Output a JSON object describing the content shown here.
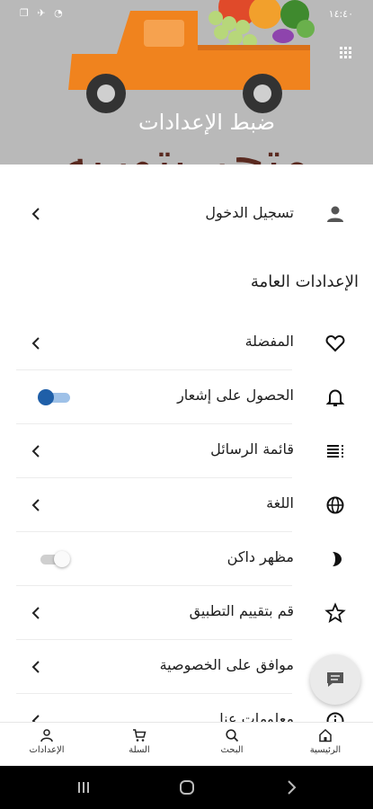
{
  "status_bar": {
    "time": "١٤:٤٠",
    "icons": "❐ ✈ ◔"
  },
  "header": {
    "title": "ضبط الإعدادات",
    "brand": "متجر بتوريه"
  },
  "login": {
    "label": "تسجيل الدخول",
    "icon": "person-icon"
  },
  "general_settings": {
    "title": "الإعدادات العامة",
    "items": [
      {
        "label": "المفضلة",
        "icon": "heart-icon",
        "control": "chevron"
      },
      {
        "label": "الحصول على إشعار",
        "icon": "bell-icon",
        "control": "toggle",
        "on": true
      },
      {
        "label": "قائمة الرسائل",
        "icon": "list-icon",
        "control": "chevron"
      },
      {
        "label": "اللغة",
        "icon": "globe-icon",
        "control": "chevron"
      },
      {
        "label": "مظهر داكن",
        "icon": "moon-icon",
        "control": "toggle",
        "on": false
      },
      {
        "label": "قم بتقييم التطبيق",
        "icon": "star-icon",
        "control": "chevron"
      },
      {
        "label": "موافق على الخصوصية",
        "icon": "shield-icon",
        "control": "chevron"
      },
      {
        "label": "معلومات عنا",
        "icon": "info-icon",
        "control": "chevron"
      }
    ]
  },
  "bottom_nav": [
    {
      "label": "الإعدادات",
      "icon": "person-icon"
    },
    {
      "label": "السلة",
      "icon": "cart-icon"
    },
    {
      "label": "البحث",
      "icon": "search-icon"
    },
    {
      "label": "الرئيسية",
      "icon": "home-icon"
    }
  ],
  "colors": {
    "accent": "#1f5fa8",
    "toggle_off": "#bdbdbd",
    "header_bg": "#b9b9b9",
    "truck": "#f0831e"
  }
}
